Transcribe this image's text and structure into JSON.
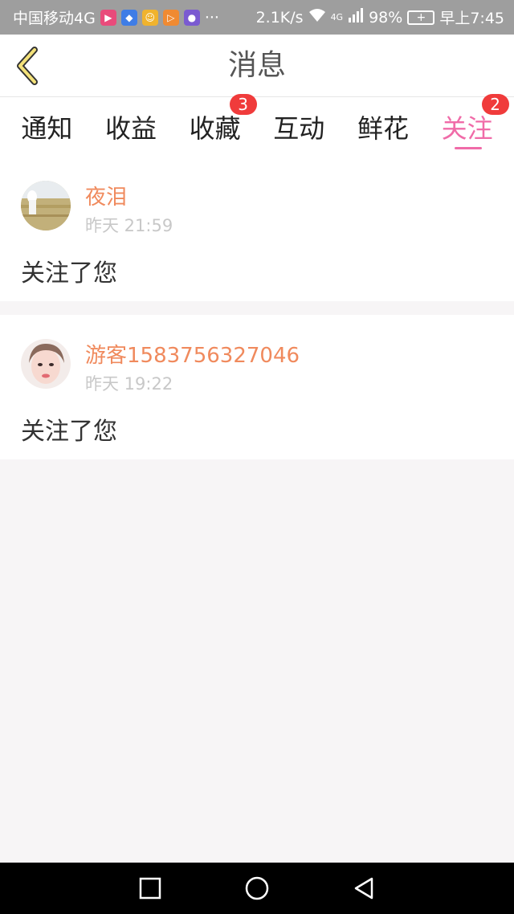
{
  "status_bar": {
    "carrier": "中国移动4G",
    "more": "···",
    "speed": "2.1K/s",
    "network": "4G",
    "battery": "98%",
    "battery_icon": "+",
    "time": "早上7:45",
    "app_icons": [
      {
        "name": "video-app-icon",
        "color": "#e94b7b",
        "glyph": "▶"
      },
      {
        "name": "baidu-app-icon",
        "color": "#3f7de6",
        "glyph": "◆"
      },
      {
        "name": "mascot-app-icon",
        "color": "#f0b32e",
        "glyph": "☺"
      },
      {
        "name": "play-app-icon",
        "color": "#f08a32",
        "glyph": "▷"
      },
      {
        "name": "purple-app-icon",
        "color": "#7a5ad1",
        "glyph": "●"
      }
    ]
  },
  "header": {
    "title": "消息",
    "back_icon": "chevron-left-icon"
  },
  "tabs": [
    {
      "label": "通知",
      "badge": ""
    },
    {
      "label": "收益",
      "badge": ""
    },
    {
      "label": "收藏",
      "badge": "3"
    },
    {
      "label": "互动",
      "badge": ""
    },
    {
      "label": "鲜花",
      "badge": ""
    },
    {
      "label": "关注",
      "badge": "2",
      "active": true
    }
  ],
  "messages": [
    {
      "username": "夜泪",
      "time": "昨天 21:59",
      "text": "关注了您",
      "avatar": "field-avatar"
    },
    {
      "username": "游客1583756327046",
      "time": "昨天 19:22",
      "text": "关注了您",
      "avatar": "girl-avatar"
    }
  ],
  "colors": {
    "accent": "#f06ba8",
    "username": "#f08a5d",
    "badge": "#f03b3b"
  }
}
